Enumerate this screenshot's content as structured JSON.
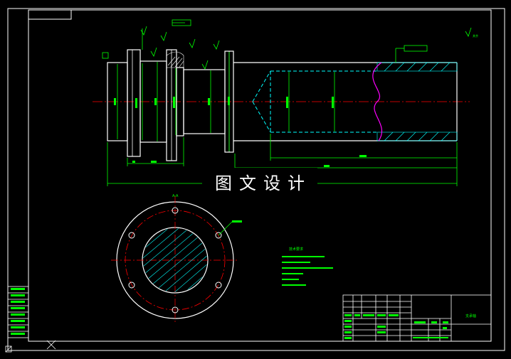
{
  "drawing": {
    "watermark": "图文设计",
    "section_label": "A-A",
    "tech_requirements_title": "技术要求",
    "title_block_name": "支承轴",
    "roughness_symbol_top_right": "其余",
    "colors": {
      "background": "#000000",
      "frame": "#ffffff",
      "part_outline": "#ffffff",
      "dimension": "#00ff00",
      "center_line": "#ff0000",
      "hidden_line": "#00ffff",
      "break_line": "#ff00ff",
      "hatch": "#00ffff",
      "title_block_text": "#00ff00"
    },
    "icons": [
      "close-x-icon",
      "ucs-icon"
    ]
  }
}
